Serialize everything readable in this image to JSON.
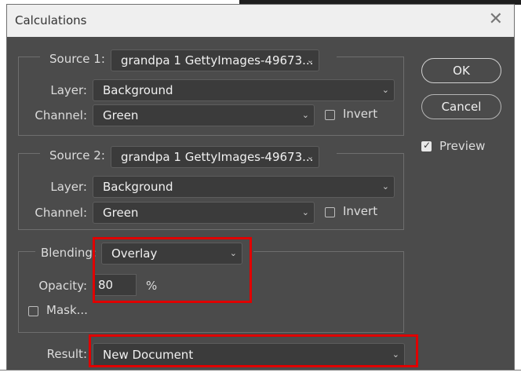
{
  "dialog": {
    "title": "Calculations"
  },
  "source1": {
    "label": "Source 1:",
    "file": "grandpa 1 GettyImages-49673...",
    "layer_label": "Layer:",
    "layer": "Background",
    "channel_label": "Channel:",
    "channel": "Green",
    "invert_label": "Invert",
    "invert_checked": false
  },
  "source2": {
    "label": "Source 2:",
    "file": "grandpa 1 GettyImages-49673...",
    "layer_label": "Layer:",
    "layer": "Background",
    "channel_label": "Channel:",
    "channel": "Green",
    "invert_label": "Invert",
    "invert_checked": false
  },
  "blending": {
    "label": "Blending:",
    "mode": "Overlay",
    "opacity_label": "Opacity:",
    "opacity": "80",
    "opacity_unit": "%",
    "mask_label": "Mask...",
    "mask_checked": false
  },
  "result": {
    "label": "Result:",
    "value": "New Document"
  },
  "buttons": {
    "ok": "OK",
    "cancel": "Cancel"
  },
  "preview": {
    "label": "Preview",
    "checked": true
  },
  "colors": {
    "highlight": "#e00000",
    "panel": "#4b4b4b",
    "field": "#3b3b3b"
  }
}
